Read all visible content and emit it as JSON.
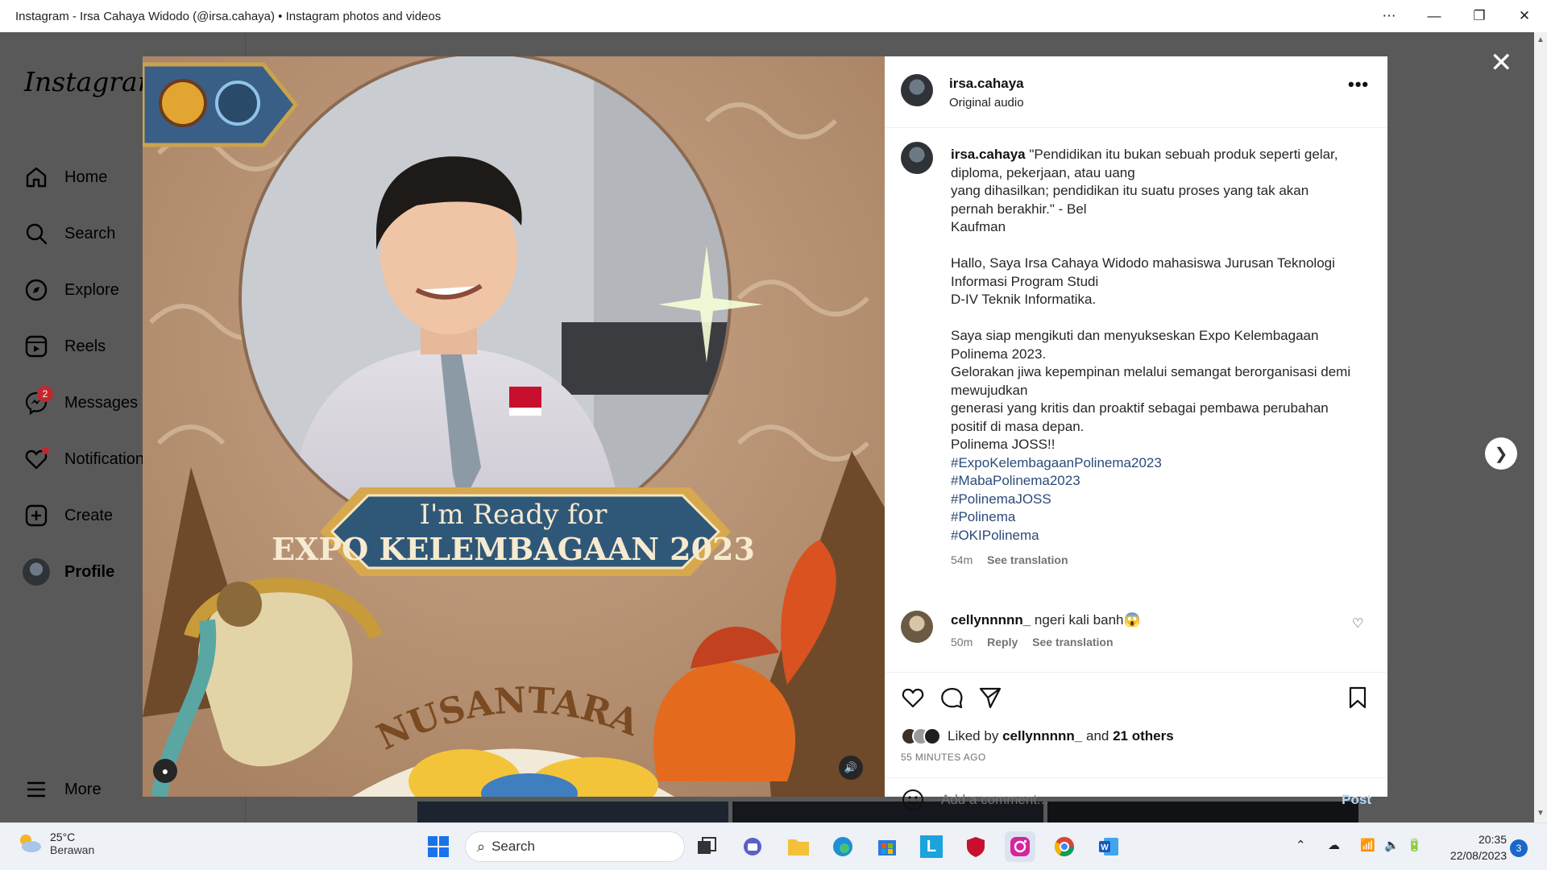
{
  "window": {
    "title": "Instagram - Irsa Cahaya Widodo (@irsa.cahaya) • Instagram photos and videos",
    "controls": [
      "more",
      "minimize",
      "restore",
      "close"
    ]
  },
  "sidebar": {
    "logo": "Instagram",
    "items": [
      {
        "label": "Home",
        "icon": "home-icon"
      },
      {
        "label": "Search",
        "icon": "search-icon"
      },
      {
        "label": "Explore",
        "icon": "compass-icon"
      },
      {
        "label": "Reels",
        "icon": "reels-icon"
      },
      {
        "label": "Messages",
        "icon": "messenger-icon",
        "badge": "2"
      },
      {
        "label": "Notifications",
        "icon": "heart-icon"
      },
      {
        "label": "Create",
        "icon": "plus-square-icon"
      },
      {
        "label": "Profile",
        "icon": "avatar"
      }
    ],
    "more_label": "More"
  },
  "post": {
    "header": {
      "username": "irsa.cahaya",
      "audio": "Original audio"
    },
    "caption": {
      "username": "irsa.cahaya",
      "lines": [
        "\"Pendidikan itu bukan sebuah produk seperti gelar, diploma, pekerjaan, atau uang",
        "yang dihasilkan; pendidikan itu suatu proses yang tak akan pernah berakhir.\" - Bel",
        "Kaufman",
        "",
        "Hallo, Saya Irsa Cahaya Widodo mahasiswa Jurusan Teknologi Informasi Program Studi",
        "D-IV Teknik Informatika.",
        "",
        "Saya siap mengikuti dan menyukseskan Expo Kelembagaan Polinema 2023.",
        "Gelorakan jiwa kepempinan melalui semangat berorganisasi demi mewujudkan",
        "generasi yang kritis dan proaktif sebagai pembawa perubahan positif di masa depan.",
        "Polinema JOSS!!"
      ],
      "hashtags": [
        "#ExpoKelembagaanPolinema2023",
        "#MabaPolinema2023",
        "#PolinemaJOSS",
        "#Polinema",
        "#OKIPolinema"
      ],
      "time": "54m",
      "see_translation": "See translation"
    },
    "comment": {
      "username": "cellynnnnn_",
      "text": "ngeri kali banh😱",
      "time": "50m",
      "reply": "Reply",
      "see_translation": "See translation"
    },
    "likes": {
      "prefix": "Liked by",
      "user": "cellynnnnn_",
      "and": "and",
      "others": "21 others"
    },
    "time_ago": "55 MINUTES AGO",
    "add_comment_placeholder": "Add a comment...",
    "post_button": "Post"
  },
  "media": {
    "banner_line1": "I'm Ready for",
    "banner_line2": "EXPO KELEMBAGAAN 2023",
    "arc_text": "NUSANTARA"
  },
  "taskbar": {
    "weather_temp": "25°C",
    "weather_desc": "Berawan",
    "search_label": "Search",
    "time": "20:35",
    "date": "22/08/2023",
    "notification_count": "3"
  },
  "colors": {
    "accent_link": "#2b4a7a",
    "notification_red": "#c0282d",
    "post_disabled": "#b3dbff",
    "media_bg": "#b99677"
  }
}
